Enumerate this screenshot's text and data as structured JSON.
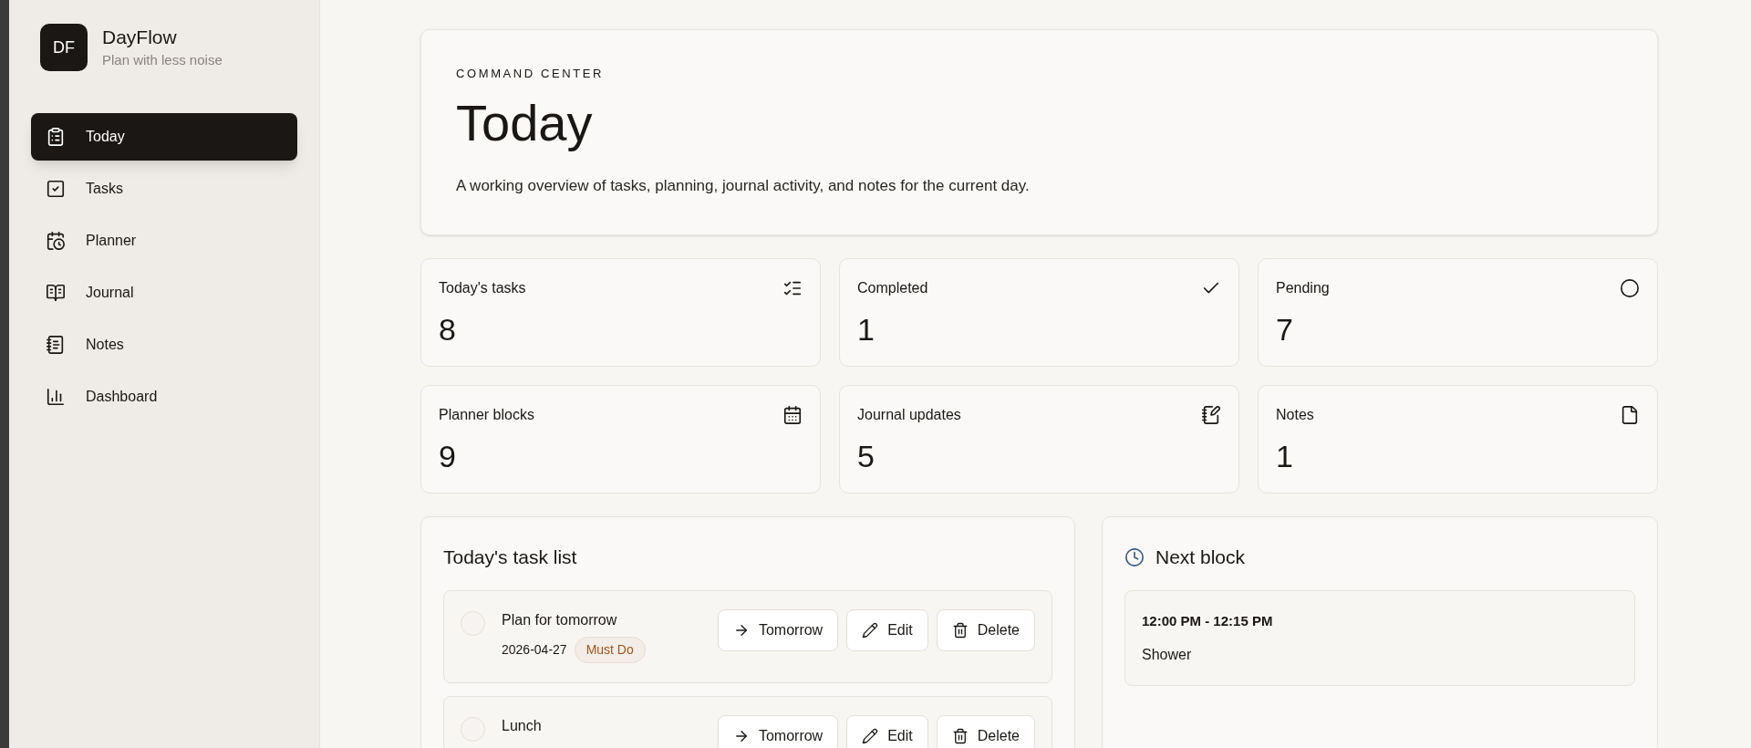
{
  "brand": {
    "logo": "DF",
    "name": "DayFlow",
    "tagline": "Plan with less noise"
  },
  "nav": [
    {
      "label": "Today",
      "selected": true
    },
    {
      "label": "Tasks",
      "selected": false
    },
    {
      "label": "Planner",
      "selected": false
    },
    {
      "label": "Journal",
      "selected": false
    },
    {
      "label": "Notes",
      "selected": false
    },
    {
      "label": "Dashboard",
      "selected": false
    }
  ],
  "hero": {
    "eyebrow": "COMMAND CENTER",
    "title": "Today",
    "description": "A working overview of tasks, planning, journal activity, and notes for the current day."
  },
  "stats": [
    {
      "label": "Today's tasks",
      "value": "8"
    },
    {
      "label": "Completed",
      "value": "1"
    },
    {
      "label": "Pending",
      "value": "7"
    },
    {
      "label": "Planner blocks",
      "value": "9"
    },
    {
      "label": "Journal updates",
      "value": "5"
    },
    {
      "label": "Notes",
      "value": "1"
    }
  ],
  "task_list": {
    "title": "Today's task list",
    "tasks": [
      {
        "title": "Plan for tomorrow",
        "date": "2026-04-27",
        "tag": "Must Do",
        "done": false,
        "buttons": [
          "Tomorrow",
          "Edit",
          "Delete"
        ]
      },
      {
        "title": "Lunch",
        "done": false,
        "buttons": [
          "Tomorrow",
          "Edit",
          "Delete"
        ]
      }
    ]
  },
  "next_block": {
    "title": "Next block",
    "time": "12:00 PM - 12:15 PM",
    "name": "Shower"
  }
}
